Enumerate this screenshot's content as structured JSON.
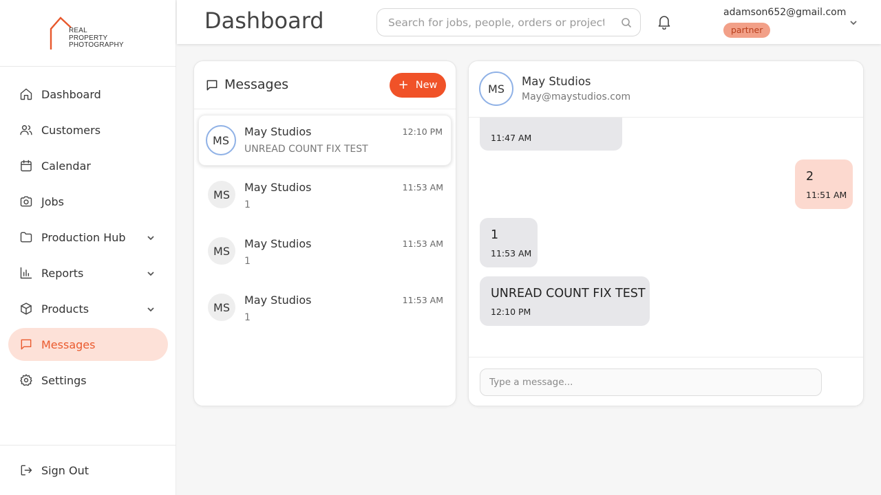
{
  "brand": {
    "line1": "REAL",
    "line2": "PROPERTY",
    "line3": "PHOTOGRAPHY",
    "accent": "#e8582c"
  },
  "sidebar": {
    "items": [
      {
        "label": "Dashboard",
        "icon": "home-icon"
      },
      {
        "label": "Customers",
        "icon": "users-icon"
      },
      {
        "label": "Calendar",
        "icon": "calendar-icon"
      },
      {
        "label": "Jobs",
        "icon": "camera-icon"
      },
      {
        "label": "Production Hub",
        "icon": "folder-icon",
        "expandable": true
      },
      {
        "label": "Reports",
        "icon": "bar-chart-icon",
        "expandable": true
      },
      {
        "label": "Products",
        "icon": "box-icon",
        "expandable": true
      },
      {
        "label": "Messages",
        "icon": "message-icon",
        "active": true
      },
      {
        "label": "Settings",
        "icon": "gear-icon"
      }
    ],
    "sign_out": "Sign Out"
  },
  "header": {
    "title": "Dashboard",
    "search_placeholder": "Search for jobs, people, orders or projects",
    "user_email": "adamson652@gmail.com",
    "user_role": "partner"
  },
  "messages": {
    "title": "Messages",
    "new_label": "New",
    "conversations": [
      {
        "initials": "MS",
        "name": "May Studios",
        "time": "12:10 PM",
        "preview": "UNREAD COUNT FIX TEST",
        "selected": true
      },
      {
        "initials": "MS",
        "name": "May Studios",
        "time": "11:53 AM",
        "preview": "1"
      },
      {
        "initials": "MS",
        "name": "May Studios",
        "time": "11:53 AM",
        "preview": "1"
      },
      {
        "initials": "MS",
        "name": "May Studios",
        "time": "11:53 AM",
        "preview": "1"
      }
    ]
  },
  "chat": {
    "initials": "MS",
    "name": "May Studios",
    "email": "May@maystudios.com",
    "messages": [
      {
        "direction": "in",
        "text": "",
        "time": "11:47 AM"
      },
      {
        "direction": "out",
        "text": "2",
        "time": "11:51 AM"
      },
      {
        "direction": "in",
        "text": "1",
        "time": "11:53 AM"
      },
      {
        "direction": "in",
        "text": "UNREAD COUNT FIX TEST",
        "time": "12:10 PM"
      }
    ],
    "input_placeholder": "Type a message..."
  }
}
